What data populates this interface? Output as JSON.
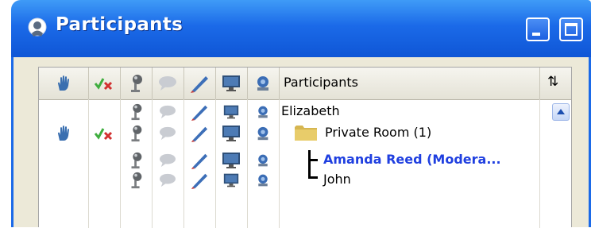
{
  "window": {
    "title": "Participants",
    "colors": {
      "titlebar": "#1b6ae8",
      "moderator": "#1f3fe0",
      "frame": "#ece9d8"
    }
  },
  "header": {
    "column_label": "Participants",
    "sort_symbol": "⇅",
    "icons": [
      "hand-icon",
      "approve-deny-icon",
      "microphone-icon",
      "chat-bubble-icon",
      "pencil-icon",
      "monitor-icon",
      "webcam-icon"
    ]
  },
  "rows": [
    {
      "name": "Elizabeth",
      "moderator": false,
      "hand": false,
      "approve": false
    },
    {
      "name": "Private Room (1)",
      "moderator": false,
      "hand": true,
      "approve": true,
      "folder": true
    },
    {
      "name": "Amanda Reed (Modera...",
      "moderator": true,
      "hand": false,
      "approve": false
    },
    {
      "name": "John",
      "moderator": false,
      "hand": false,
      "approve": false
    }
  ]
}
